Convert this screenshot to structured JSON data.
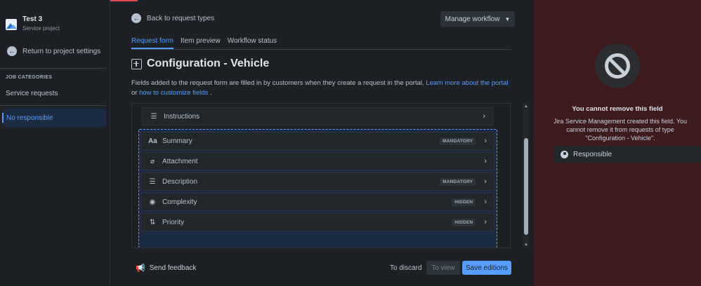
{
  "sidebar": {
    "project_name": "Test 3",
    "project_type": "Service project",
    "back_label": "Return to project settings",
    "section_heading": "JOB CATEGORIES",
    "items": [
      {
        "label": "Service requests"
      },
      {
        "label": "No responsible",
        "selected": true
      }
    ]
  },
  "main": {
    "back_label": "Back to request types",
    "manage_workflow": "Manage workflow",
    "tabs": [
      {
        "label": "Request form",
        "active": true
      },
      {
        "label": "Item preview"
      },
      {
        "label": "Workflow status"
      }
    ],
    "title": "Configuration - Vehicle",
    "description": {
      "text1": "Fields added to the request form are filled in by customers when they create a request in the portal.",
      "link1": "Learn more about the portal",
      "text2": "or",
      "link2": "how to customize fields",
      "text3": "."
    },
    "fields": [
      {
        "label": "Instructions",
        "icon": "lines-icon",
        "badge": ""
      },
      {
        "label": "Summary",
        "icon": "text-icon",
        "badge": "MANDATORY"
      },
      {
        "label": "Attachment",
        "icon": "paperclip-icon",
        "badge": ""
      },
      {
        "label": "Description",
        "icon": "lines-icon",
        "badge": "MANDATORY"
      },
      {
        "label": "Complexity",
        "icon": "dropdown-icon",
        "badge": "HIDDEN"
      },
      {
        "label": "Priority",
        "icon": "priority-icon",
        "badge": "HIDDEN"
      }
    ],
    "footer": {
      "feedback": "Send feedback",
      "discard": "To discard",
      "view": "To view",
      "save": "Save editions"
    }
  },
  "panel": {
    "title": "You cannot remove this field",
    "description": "Jira Service Management created this field. You cannot remove it from requests of type \"Configuration - Vehicle\".",
    "field": "Responsible"
  },
  "colors": {
    "accent": "#579dff",
    "panel_bg": "#3d1b1d",
    "page_bg": "#1d2125"
  }
}
